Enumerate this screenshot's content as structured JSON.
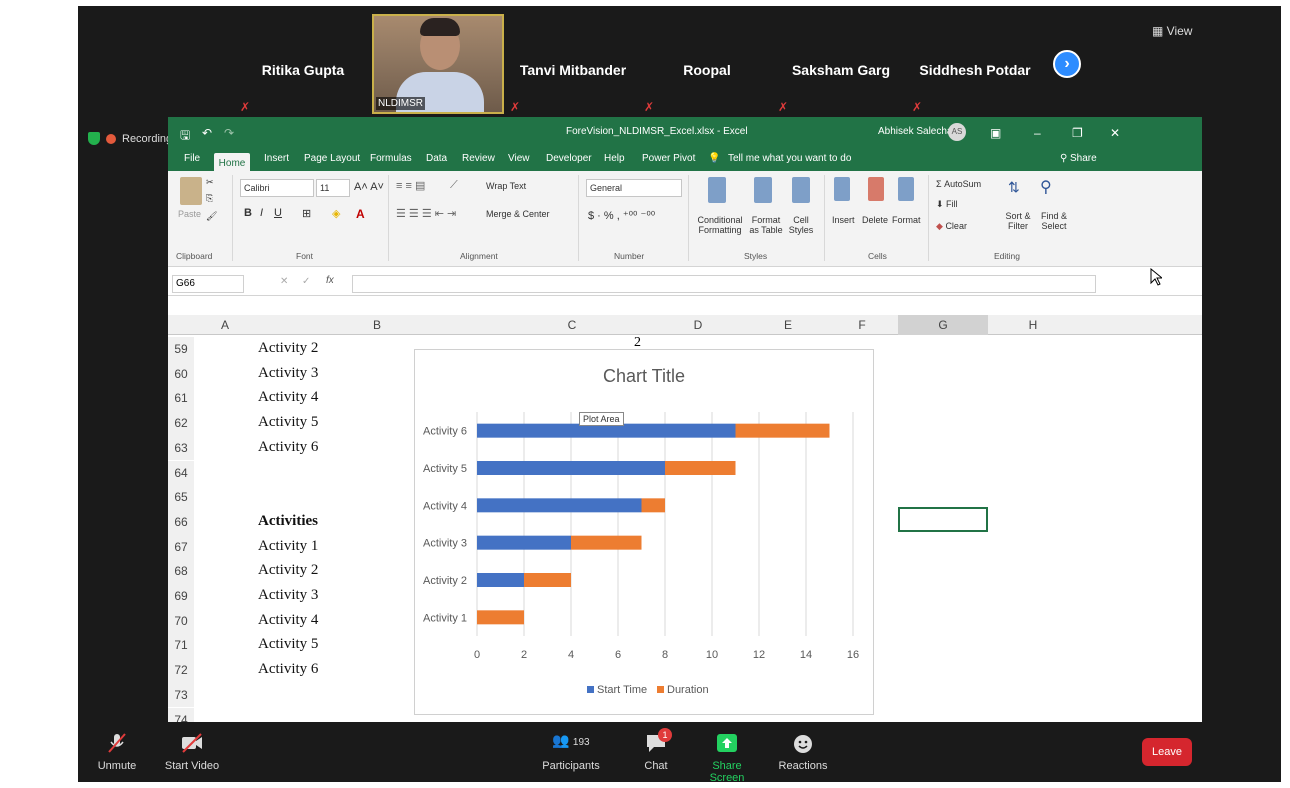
{
  "meeting": {
    "view_label": "View",
    "recording_label": "Recording",
    "participants": [
      {
        "name": "Ritika Gupta"
      },
      {
        "name": "Tanvi Mitbander"
      },
      {
        "name": "Roopal"
      },
      {
        "name": "Saksham Garg"
      },
      {
        "name": "Siddhesh Potdar"
      }
    ],
    "video_label": "NLDIMSR",
    "toolbar": {
      "unmute": "Unmute",
      "start_video": "Start Video",
      "participants": "Participants",
      "participants_count": "193",
      "chat": "Chat",
      "chat_badge": "1",
      "share_screen": "Share Screen",
      "reactions": "Reactions",
      "leave": "Leave"
    }
  },
  "excel": {
    "file_title": "ForeVision_NLDIMSR_Excel.xlsx - Excel",
    "user_name": "Abhisek Salecha",
    "user_initials": "AS",
    "tabs": [
      "File",
      "Home",
      "Insert",
      "Page Layout",
      "Formulas",
      "Data",
      "Review",
      "View",
      "Developer",
      "Help",
      "Power Pivot"
    ],
    "tell_me": "Tell me what you want to do",
    "share": "Share",
    "ribbon": {
      "paste": "Paste",
      "clipboard": "Clipboard",
      "font_name": "Calibri",
      "font_size": "11",
      "font": "Font",
      "wrap_text": "Wrap Text",
      "merge_center": "Merge & Center",
      "alignment": "Alignment",
      "number_format": "General",
      "number": "Number",
      "conditional_formatting": "Conditional Formatting",
      "format_as_table": "Format as Table",
      "cell_styles": "Cell Styles",
      "styles": "Styles",
      "insert": "Insert",
      "delete": "Delete",
      "format": "Format",
      "cells": "Cells",
      "autosum": "AutoSum",
      "fill": "Fill",
      "clear": "Clear",
      "sort_filter": "Sort & Filter",
      "find_select": "Find & Select",
      "editing": "Editing"
    },
    "name_box": "G66",
    "columns": [
      "A",
      "B",
      "C",
      "D",
      "E",
      "F",
      "G",
      "H"
    ],
    "rows": [
      {
        "num": "59",
        "b": "Activity 2",
        "bold": false
      },
      {
        "num": "60",
        "b": "Activity 3",
        "bold": false
      },
      {
        "num": "61",
        "b": "Activity 4",
        "bold": false
      },
      {
        "num": "62",
        "b": "Activity 5",
        "bold": false
      },
      {
        "num": "63",
        "b": "Activity 6",
        "bold": false
      },
      {
        "num": "64",
        "b": "",
        "bold": false
      },
      {
        "num": "65",
        "b": "",
        "bold": false
      },
      {
        "num": "66",
        "b": "Activities",
        "bold": true
      },
      {
        "num": "67",
        "b": "Activity 1",
        "bold": false
      },
      {
        "num": "68",
        "b": "Activity 2",
        "bold": false
      },
      {
        "num": "69",
        "b": "Activity 3",
        "bold": false
      },
      {
        "num": "70",
        "b": "Activity 4",
        "bold": false
      },
      {
        "num": "71",
        "b": "Activity 5",
        "bold": false
      },
      {
        "num": "72",
        "b": "Activity 6",
        "bold": false
      },
      {
        "num": "73",
        "b": "",
        "bold": false
      },
      {
        "num": "74",
        "b": "",
        "bold": false
      }
    ],
    "cell_c59": "2",
    "plot_area_tooltip": "Plot Area"
  },
  "chart_data": {
    "type": "bar",
    "orientation": "horizontal",
    "stacked": true,
    "title": "Chart Title",
    "categories": [
      "Activity 1",
      "Activity 2",
      "Activity 3",
      "Activity 4",
      "Activity 5",
      "Activity 6"
    ],
    "series": [
      {
        "name": "Start Time",
        "color": "#4472c4",
        "values": [
          0,
          2,
          4,
          7,
          8,
          11
        ]
      },
      {
        "name": "Duration",
        "color": "#ed7d31",
        "values": [
          2,
          2,
          3,
          1,
          3,
          4
        ]
      }
    ],
    "x_ticks": [
      "0",
      "2",
      "4",
      "6",
      "8",
      "10",
      "12",
      "14",
      "16"
    ],
    "xlim": [
      0,
      16
    ],
    "grid": true,
    "legend": "bottom"
  }
}
